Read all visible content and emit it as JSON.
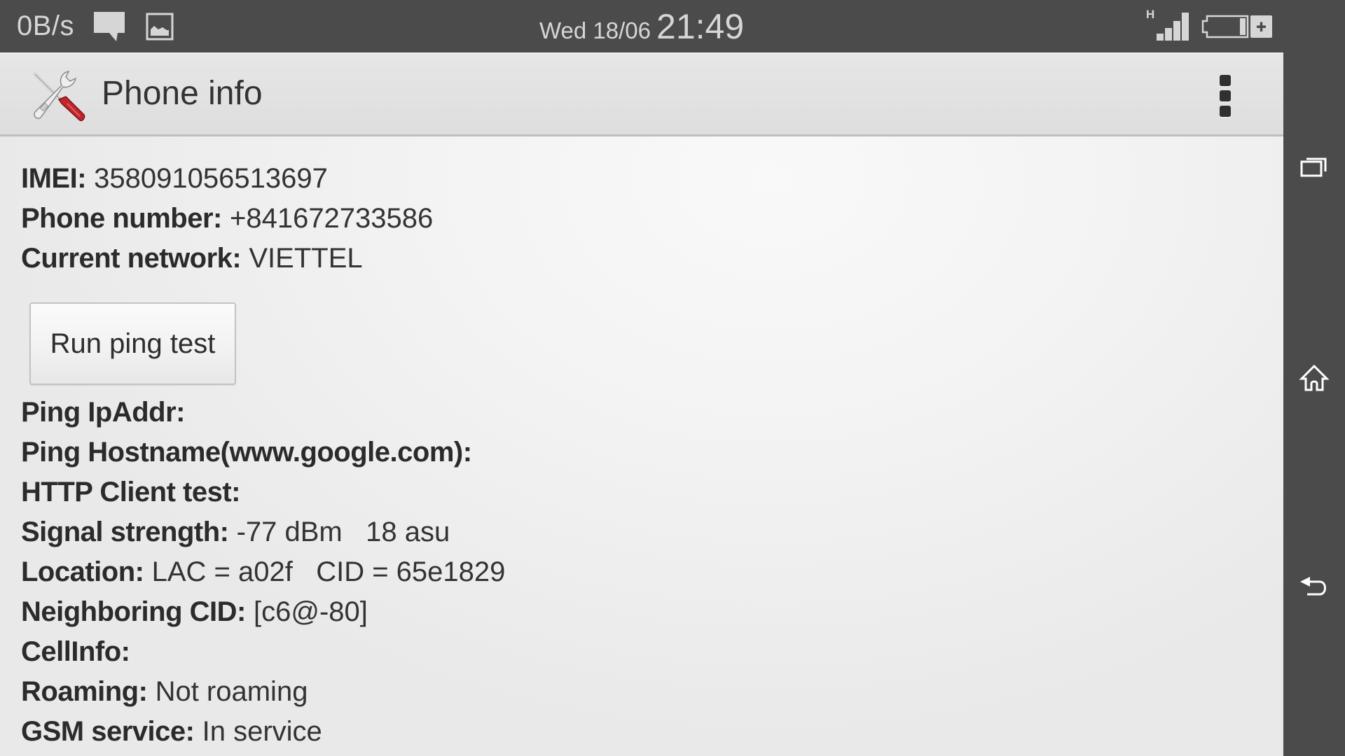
{
  "status_bar": {
    "data_speed": "0B/s",
    "date": "Wed 18/06",
    "time": "21:49",
    "network_type": "H",
    "notification_icons": [
      "message-icon",
      "image-icon"
    ],
    "signal_icon": "signal-bars-icon",
    "battery_icon": "battery-charging-icon",
    "colors": {
      "background": "#4b4b4b",
      "foreground": "#d6d6d6"
    }
  },
  "action_bar": {
    "title": "Phone info",
    "app_icon": "tools-icon",
    "overflow_icon": "overflow-menu-icon"
  },
  "info": {
    "imei": {
      "label": "IMEI:",
      "value": "358091056513697"
    },
    "phone_number": {
      "label": "Phone number:",
      "value": "+841672733586"
    },
    "current_network": {
      "label": "Current network:",
      "value": "VIETTEL"
    },
    "ping_button_label": "Run ping test",
    "ping_ipaddr": {
      "label": "Ping IpAddr:",
      "value": ""
    },
    "ping_hostname": {
      "label": "Ping Hostname(www.google.com):",
      "value": ""
    },
    "http_client_test": {
      "label": "HTTP Client test:",
      "value": ""
    },
    "signal_strength": {
      "label": "Signal strength:",
      "value": "-77 dBm   18 asu"
    },
    "location": {
      "label": "Location:",
      "value": "LAC = a02f   CID = 65e1829"
    },
    "neighboring_cid": {
      "label": "Neighboring CID:",
      "value": "[c6@-80]"
    },
    "cellinfo": {
      "label": "CellInfo:",
      "value": ""
    },
    "roaming": {
      "label": "Roaming:",
      "value": "Not roaming"
    },
    "gsm_service": {
      "label": "GSM service:",
      "value": "In service"
    }
  },
  "nav_bar": {
    "buttons": [
      {
        "name": "recent-apps",
        "icon": "recent-apps-icon"
      },
      {
        "name": "home",
        "icon": "home-icon"
      },
      {
        "name": "back",
        "icon": "back-icon"
      }
    ]
  }
}
